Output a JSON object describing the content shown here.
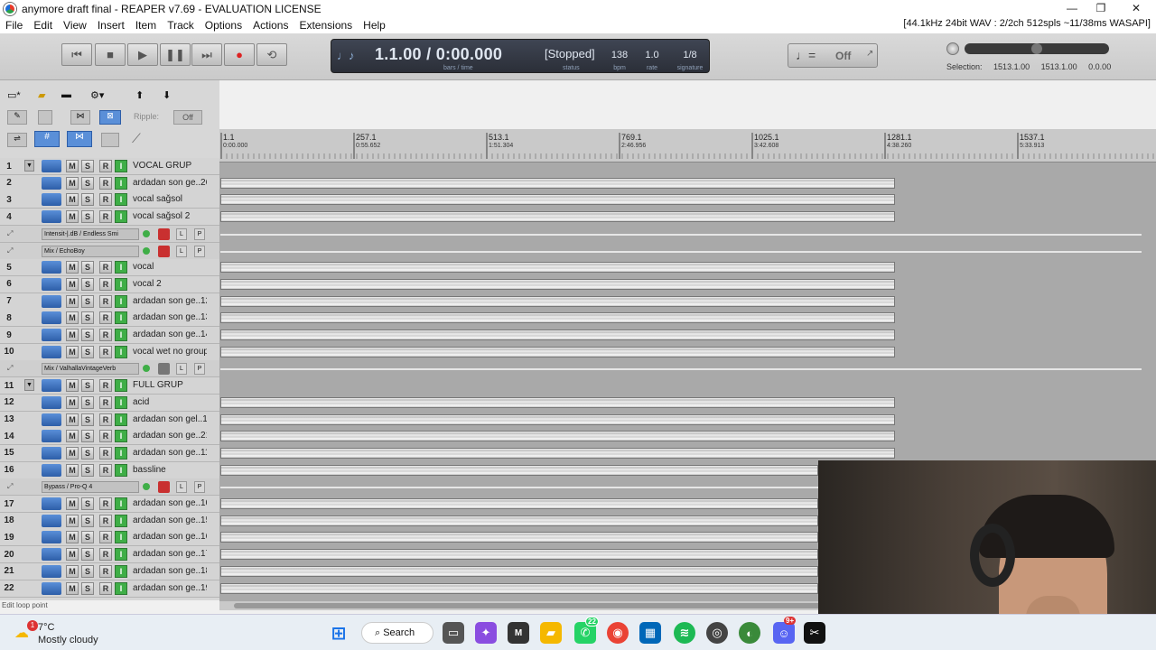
{
  "window": {
    "title": "anymore draft final - REAPER v7.69 - EVALUATION LICENSE",
    "min": "—",
    "restore": "❐",
    "close": "✕"
  },
  "menu": [
    "File",
    "Edit",
    "View",
    "Insert",
    "Item",
    "Track",
    "Options",
    "Actions",
    "Extensions",
    "Help"
  ],
  "audio_status": "[44.1kHz 24bit WAV : 2/2ch 512spls ~11/38ms WASAPI]",
  "transport": {
    "position": "1.1.00 / 0:00.000",
    "position_sub": "bars / time",
    "status": "[Stopped]",
    "status_sub": "status",
    "bpm": "138",
    "bpm_sub": "bpm",
    "rate": "1.0",
    "rate_sub": "rate",
    "signature": "1/8",
    "signature_sub": "signature"
  },
  "metronome": {
    "state": "Off"
  },
  "selection": {
    "label": "Selection:",
    "start": "1513.1.00",
    "end": "1513.1.00",
    "length": "0.0.00"
  },
  "ripple": {
    "label": "Ripple:",
    "value": "Off"
  },
  "ruler": {
    "marks": [
      {
        "bar": "1.1",
        "time": "0:00.000"
      },
      {
        "bar": "257.1",
        "time": "0:55.652"
      },
      {
        "bar": "513.1",
        "time": "1:51.304"
      },
      {
        "bar": "769.1",
        "time": "2:46.956"
      },
      {
        "bar": "1025.1",
        "time": "3:42.608"
      },
      {
        "bar": "1281.1",
        "time": "4:38.260"
      },
      {
        "bar": "1537.1",
        "time": "5:33.913"
      }
    ]
  },
  "tracks": [
    {
      "type": "track",
      "num": "1",
      "name": "VOCAL GRUP",
      "folder": true
    },
    {
      "type": "track",
      "num": "2",
      "name": "ardadan son ge..26"
    },
    {
      "type": "track",
      "num": "3",
      "name": "vocal sağsol"
    },
    {
      "type": "track",
      "num": "4",
      "name": "vocal sağsol 2"
    },
    {
      "type": "env",
      "name": "Intensit-|.dB / Endless Smi",
      "armed": true
    },
    {
      "type": "env",
      "name": "Mix / EchoBoy",
      "armed": true
    },
    {
      "type": "track",
      "num": "5",
      "name": "vocal"
    },
    {
      "type": "track",
      "num": "6",
      "name": "vocal 2"
    },
    {
      "type": "track",
      "num": "7",
      "name": "ardadan son ge..12"
    },
    {
      "type": "track",
      "num": "8",
      "name": "ardadan son ge..13"
    },
    {
      "type": "track",
      "num": "9",
      "name": "ardadan son ge..14"
    },
    {
      "type": "track",
      "num": "10",
      "name": "vocal wet no group"
    },
    {
      "type": "env",
      "name": "Mix / ValhallaVintageVerb",
      "armed": false
    },
    {
      "type": "track",
      "num": "11",
      "name": "FULL GRUP",
      "folder": true
    },
    {
      "type": "track",
      "num": "12",
      "name": "acid"
    },
    {
      "type": "track",
      "num": "13",
      "name": "ardadan son gel..1"
    },
    {
      "type": "track",
      "num": "14",
      "name": "ardadan son ge..21"
    },
    {
      "type": "track",
      "num": "15",
      "name": "ardadan son ge..11"
    },
    {
      "type": "track",
      "num": "16",
      "name": "bassline"
    },
    {
      "type": "env",
      "name": "Bypass / Pro-Q 4",
      "armed": true
    },
    {
      "type": "track",
      "num": "17",
      "name": "ardadan son ge..10"
    },
    {
      "type": "track",
      "num": "18",
      "name": "ardadan son ge..15"
    },
    {
      "type": "track",
      "num": "19",
      "name": "ardadan son ge..16"
    },
    {
      "type": "track",
      "num": "20",
      "name": "ardadan son ge..17"
    },
    {
      "type": "track",
      "num": "21",
      "name": "ardadan son ge..18"
    },
    {
      "type": "track",
      "num": "22",
      "name": "ardadan son ge..19"
    }
  ],
  "track_buttons": {
    "mute": "M",
    "solo": "S",
    "record": "R",
    "input": "I",
    "latch": "L",
    "play": "P"
  },
  "statusline": "Edit loop point",
  "weather": {
    "temp": "7°C",
    "desc": "Mostly cloudy",
    "badge": "1"
  },
  "taskbar": {
    "search": "Search",
    "whatsapp_badge": "22",
    "discord_badge": "9+"
  }
}
